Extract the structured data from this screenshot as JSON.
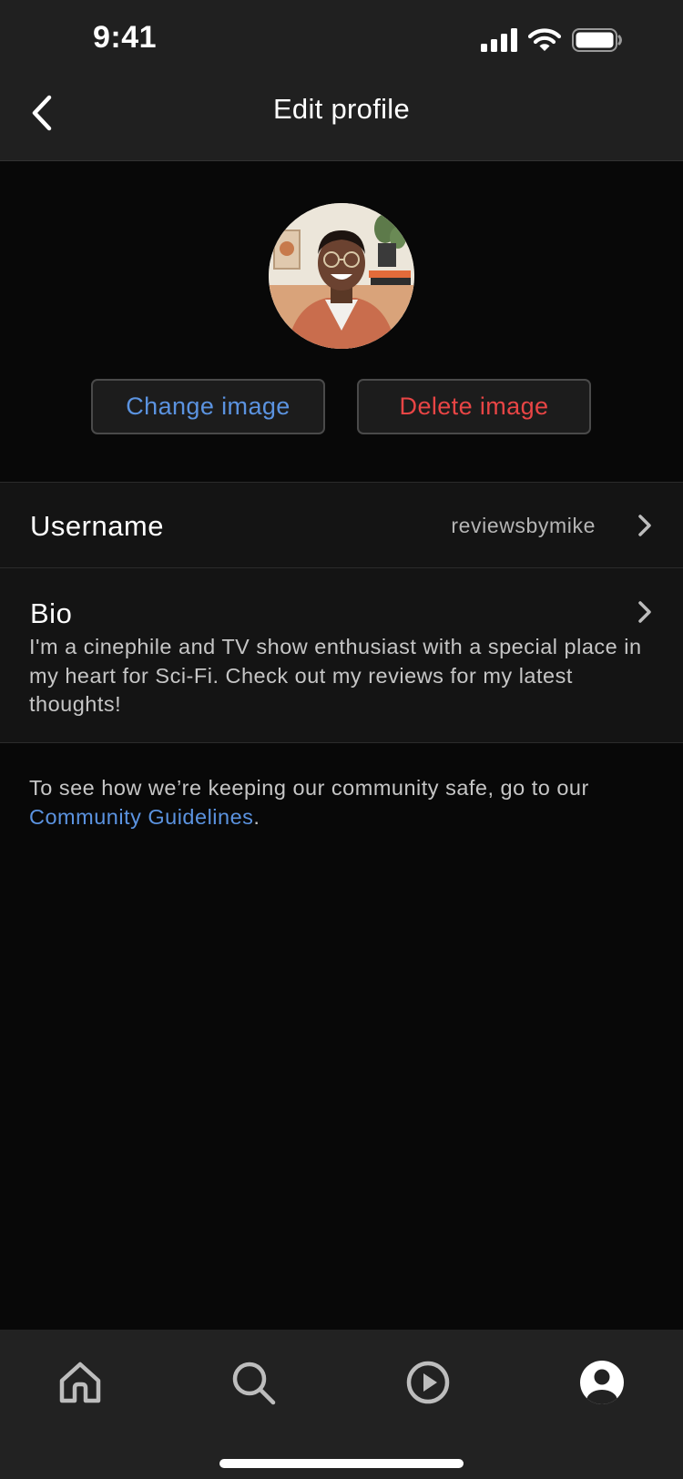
{
  "status_bar": {
    "time": "9:41",
    "icons": [
      "cellular-signal-icon",
      "wifi-icon",
      "battery-icon"
    ]
  },
  "header": {
    "title": "Edit profile",
    "back_icon": "chevron-left-icon"
  },
  "profile_image": {
    "change_label": "Change image",
    "delete_label": "Delete image"
  },
  "fields": {
    "username": {
      "label": "Username",
      "value": "reviewsbymike"
    },
    "bio": {
      "label": "Bio",
      "value": "I'm a cinephile and TV show enthusiast with a special place in my heart for Sci-Fi. Check out my reviews for my latest thoughts!"
    }
  },
  "guidelines": {
    "text": "To see how we’re keeping our community safe, go to our",
    "link": "Community Guidelines",
    "suffix": "."
  },
  "tab_bar": {
    "tabs": [
      {
        "name": "home",
        "icon": "home-icon",
        "active": false
      },
      {
        "name": "search",
        "icon": "search-icon",
        "active": false
      },
      {
        "name": "play",
        "icon": "play-circle-icon",
        "active": false
      },
      {
        "name": "profile",
        "icon": "profile-icon",
        "active": true
      }
    ]
  },
  "colors": {
    "background": "#080808",
    "surface": "#141414",
    "bar": "#222222",
    "accent_blue": "#5b93e0",
    "destructive_red": "#e84545",
    "secondary_text": "#c6c6c6"
  }
}
